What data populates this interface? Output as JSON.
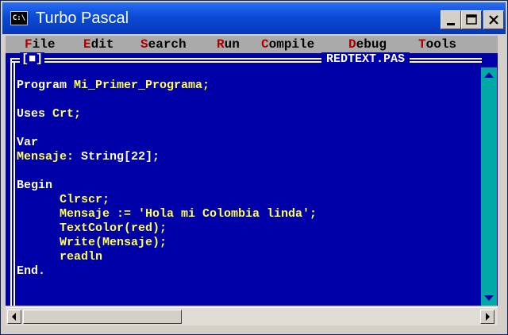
{
  "window": {
    "title": "Turbo Pascal",
    "icon_label": "C:\\",
    "minimize_label": "_",
    "maximize_label": "□",
    "close_label": "×"
  },
  "menu": {
    "items": [
      {
        "hotkey": "F",
        "rest": "ile"
      },
      {
        "hotkey": "E",
        "rest": "dit"
      },
      {
        "hotkey": "S",
        "rest": "earch"
      },
      {
        "hotkey": "R",
        "rest": "un"
      },
      {
        "hotkey": "C",
        "rest": "ompile"
      },
      {
        "hotkey": "D",
        "rest": "ebug"
      },
      {
        "hotkey": "T",
        "rest": "ools"
      }
    ]
  },
  "editor": {
    "close_box": "[■]",
    "filename": "REDTEXT.PAS",
    "lines": [
      {
        "kw": "Program ",
        "id": "Mi_Primer_Programa;"
      },
      {
        "kw": "",
        "id": ""
      },
      {
        "kw": "Uses ",
        "id": "Crt;"
      },
      {
        "kw": "",
        "id": ""
      },
      {
        "kw": "Var",
        "id": ""
      },
      {
        "kw": "",
        "id": "Mensaje: ",
        "kw2": "String[22];"
      },
      {
        "kw": "",
        "id": ""
      },
      {
        "kw": "Begin",
        "id": ""
      },
      {
        "kw": "",
        "id": "      Clrscr;"
      },
      {
        "kw": "",
        "id": "      Mensaje := 'Hola mi Colombia linda';"
      },
      {
        "kw": "",
        "id": "      TextColor(red);"
      },
      {
        "kw": "",
        "id": "      Write(Mensaje);"
      },
      {
        "kw": "",
        "id": "      readln"
      },
      {
        "kw": "End.",
        "id": ""
      }
    ]
  },
  "colors": {
    "background": "#0000a8",
    "keyword": "#ffffff",
    "identifier": "#ffff55",
    "menubar": "#aaaaaa",
    "hotkey": "#a80000",
    "scrollbar": "#00a8a8"
  }
}
